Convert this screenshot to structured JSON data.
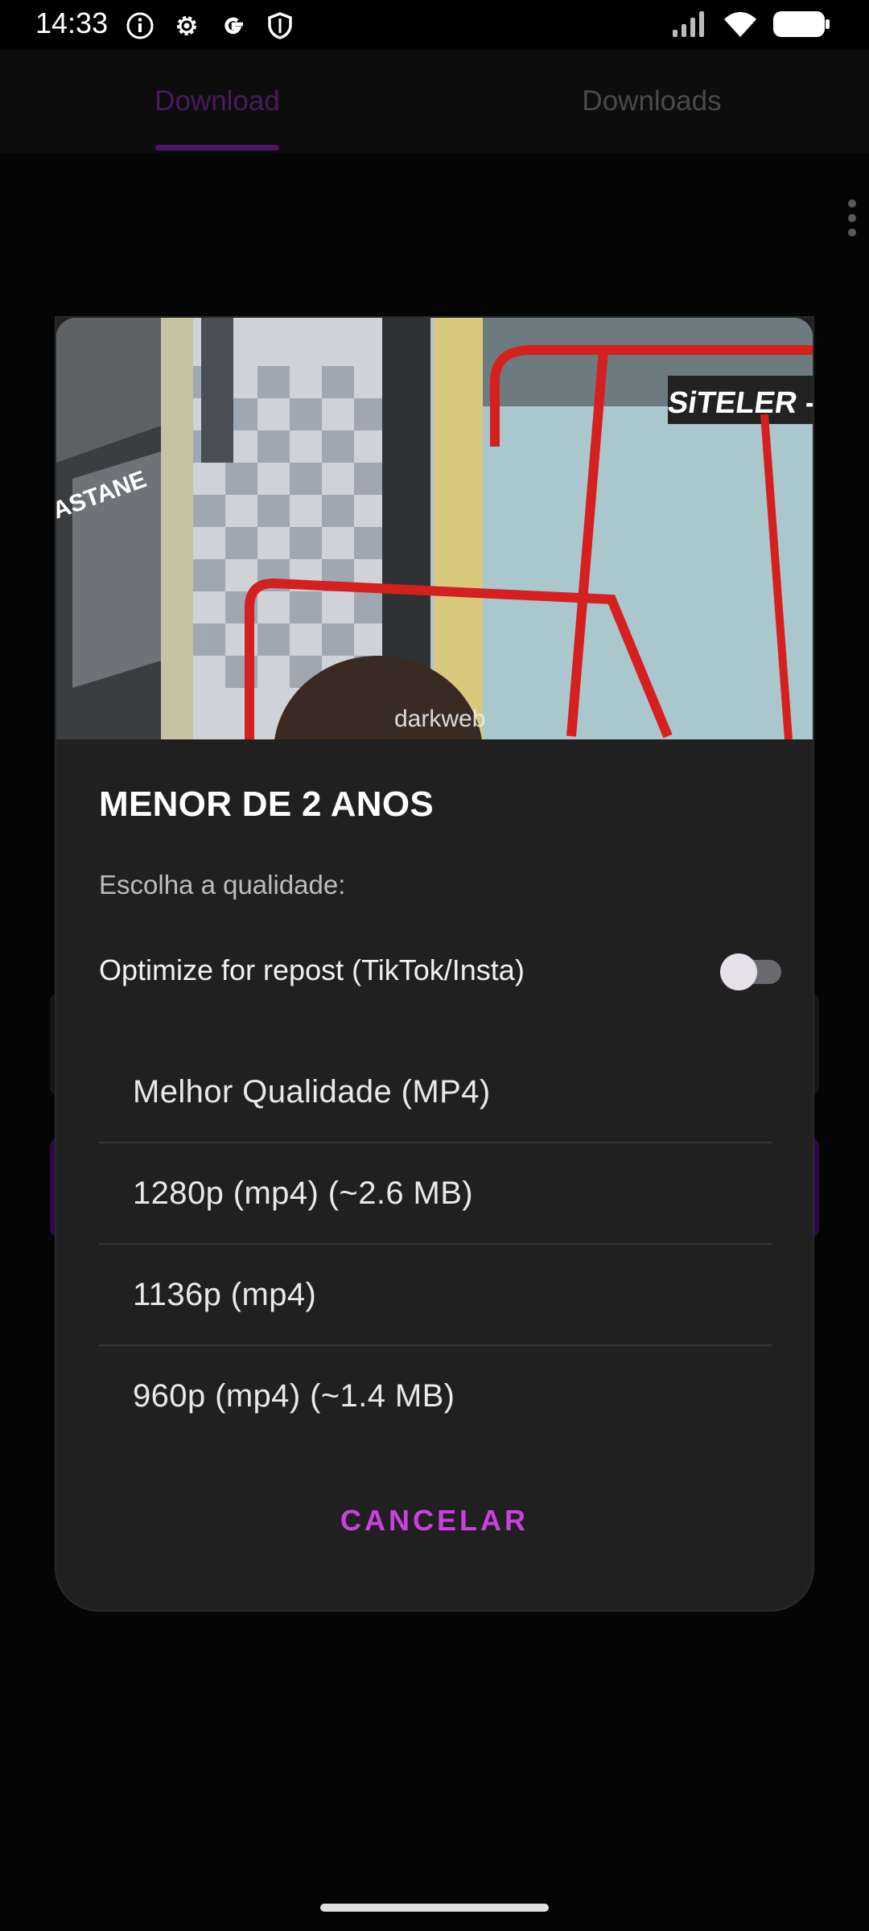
{
  "status_bar": {
    "time": "14:33",
    "left_icons": [
      "info-icon",
      "settings-gear-icon",
      "google-icon",
      "shield-icon"
    ],
    "right_icons": [
      "signal-icon",
      "wifi-icon",
      "battery-icon"
    ]
  },
  "tabs": [
    {
      "label": "Download",
      "selected": true
    },
    {
      "label": "Downloads",
      "selected": false
    }
  ],
  "colors": {
    "accent": "#cc3fe0",
    "dialog_bg": "#202021",
    "scrim_tab_selected": "#4c1860"
  },
  "dialog": {
    "thumbnail_texts": {
      "sign": "SiTELER -H",
      "side_text": "ASTANE",
      "watermark": "darkweb"
    },
    "title": "MENOR DE 2 ANOS",
    "subtitle": "Escolha a qualidade:",
    "optimize": {
      "label": "Optimize for repost (TikTok/Insta)",
      "enabled": false
    },
    "options": [
      "Melhor Qualidade (MP4)",
      "1280p (mp4) (~2.6 MB)",
      "1136p (mp4)",
      "960p (mp4) (~1.4 MB)"
    ],
    "cancel_label": "CANCELAR"
  }
}
